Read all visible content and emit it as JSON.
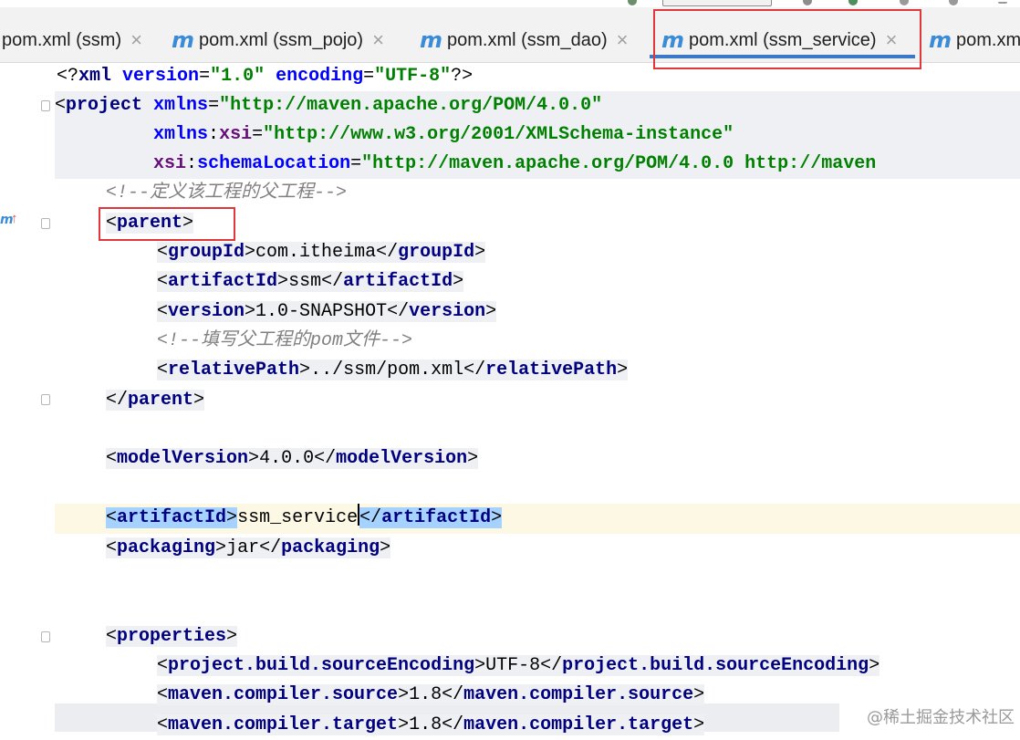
{
  "tabs": [
    {
      "label": "pom.xml (ssm)",
      "icon": "maven-icon",
      "active": false,
      "show_icon": false
    },
    {
      "label": "pom.xml (ssm_pojo)",
      "icon": "maven-icon",
      "active": false,
      "show_icon": true
    },
    {
      "label": "pom.xml (ssm_dao)",
      "icon": "maven-icon",
      "active": false,
      "show_icon": true
    },
    {
      "label": "pom.xml (ssm_service)",
      "icon": "maven-icon",
      "active": true,
      "show_icon": true
    },
    {
      "label": "pom.xm",
      "icon": "maven-icon",
      "active": false,
      "show_icon": true
    }
  ],
  "tab_icon_glyph": "m",
  "close_glyph": "×",
  "gutter": {
    "marker_glyph": "m",
    "arrow_glyph": "↑"
  },
  "code": {
    "decl": {
      "pre": "<?",
      "name": "xml",
      "a1": "version",
      "v1": "\"1.0\"",
      "a2": "encoding",
      "v2": "\"UTF-8\"",
      "post": "?>"
    },
    "project_open": {
      "lt": "<",
      "name": "project",
      "attr": "xmlns",
      "eq": "=",
      "val": "\"http://maven.apache.org/POM/4.0.0\""
    },
    "project_xsi": {
      "ns": "xmlns",
      "colon": ":",
      "attr": "xsi",
      "eq": "=",
      "val": "\"http://www.w3.org/2001/XMLSchema-instance\""
    },
    "project_schema": {
      "ns": "xsi",
      "colon": ":",
      "attr": "schemaLocation",
      "eq": "=",
      "val": "\"http://maven.apache.org/POM/4.0.0 http://maven"
    },
    "comment_parent": "<!--定义该工程的父工程-->",
    "parent_open": "parent",
    "groupId": {
      "tag": "groupId",
      "value": "com.itheima"
    },
    "artifactId_parent": {
      "tag": "artifactId",
      "value": "ssm"
    },
    "version": {
      "tag": "version",
      "value": "1.0-SNAPSHOT"
    },
    "comment_pom": "<!--填写父工程的pom文件-->",
    "relativePath": {
      "tag": "relativePath",
      "value": "../ssm/pom.xml"
    },
    "parent_close": "parent",
    "modelVersion": {
      "tag": "modelVersion",
      "value": "4.0.0"
    },
    "artifactId": {
      "tag": "artifactId",
      "value": "ssm_service"
    },
    "packaging": {
      "tag": "packaging",
      "value": "jar"
    },
    "properties_open": "properties",
    "encoding": {
      "tag": "project.build.sourceEncoding",
      "value": "UTF-8"
    },
    "compiler_source": {
      "tag": "maven.compiler.source",
      "value": "1.8"
    },
    "compiler_target": {
      "tag": "maven.compiler.target",
      "value": "1.8"
    }
  },
  "watermark": "@稀土掘金技术社区",
  "colors": {
    "tag": "#000080",
    "attr": "#0000ff",
    "value": "#008000",
    "comment": "#808080",
    "selection": "#a6d2ff",
    "highlight_box": "#e0373a",
    "tab_active": "#3c78c8"
  }
}
